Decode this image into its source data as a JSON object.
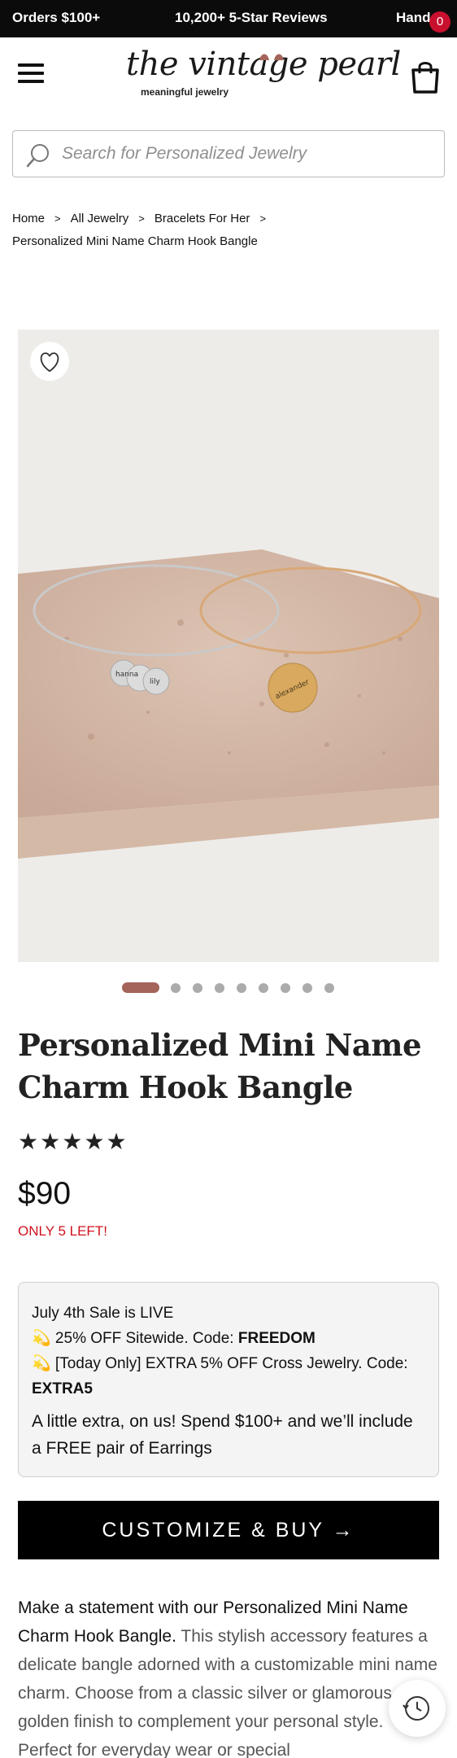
{
  "announcement": {
    "items": [
      "Orders $100+",
      "10,200+ 5-Star Reviews",
      "Handcr"
    ]
  },
  "header": {
    "logo_text": "the vintage pearl",
    "logo_tagline": "meaningful jewelry",
    "cart_count": "0",
    "icons": {
      "menu": "hamburger-menu-icon",
      "cart": "shopping-bag-icon"
    }
  },
  "search": {
    "placeholder": "Search for Personalized Jewelry",
    "value": ""
  },
  "breadcrumb": {
    "items": [
      "Home",
      "All Jewelry",
      "Bracelets For Her",
      "Personalized Mini Name Charm Hook Bangle"
    ]
  },
  "gallery": {
    "image_count": 9,
    "active_index": 0,
    "charm_text": [
      "hanna",
      "lily",
      "alexander"
    ]
  },
  "product": {
    "title": "Personalized Mini Name Charm Hook Bangle",
    "rating_stars": 5,
    "price": "$90",
    "stock_message": "ONLY 5 LEFT!"
  },
  "promo": {
    "heading": "July 4th Sale is LIVE",
    "line1_prefix": "💫 25% OFF Sitewide. Code: ",
    "line1_code": "FREEDOM",
    "line2_prefix": "💫 [Today Only] EXTRA 5% OFF Cross Jewelry. Code:",
    "line2_code": "EXTRA5",
    "extra": "A little extra, on us! Spend $100+ and we’ll include a FREE pair of Earrings"
  },
  "cta": {
    "label": "CUSTOMIZE & BUY →"
  },
  "description": {
    "bold": "Make a statement with our Personalized Mini Name Charm Hook Bangle.",
    "text": " This stylish accessory features a delicate bangle adorned with a customizable mini name charm. Choose from a classic silver or glamorous golden finish to complement your personal style. Perfect for everyday wear or special"
  },
  "colors": {
    "announce_bg": "#0b0b0b",
    "badge": "#c8102e",
    "active_dot": "#a4645a",
    "stock": "#d0121e",
    "cta_bg": "#000000"
  }
}
